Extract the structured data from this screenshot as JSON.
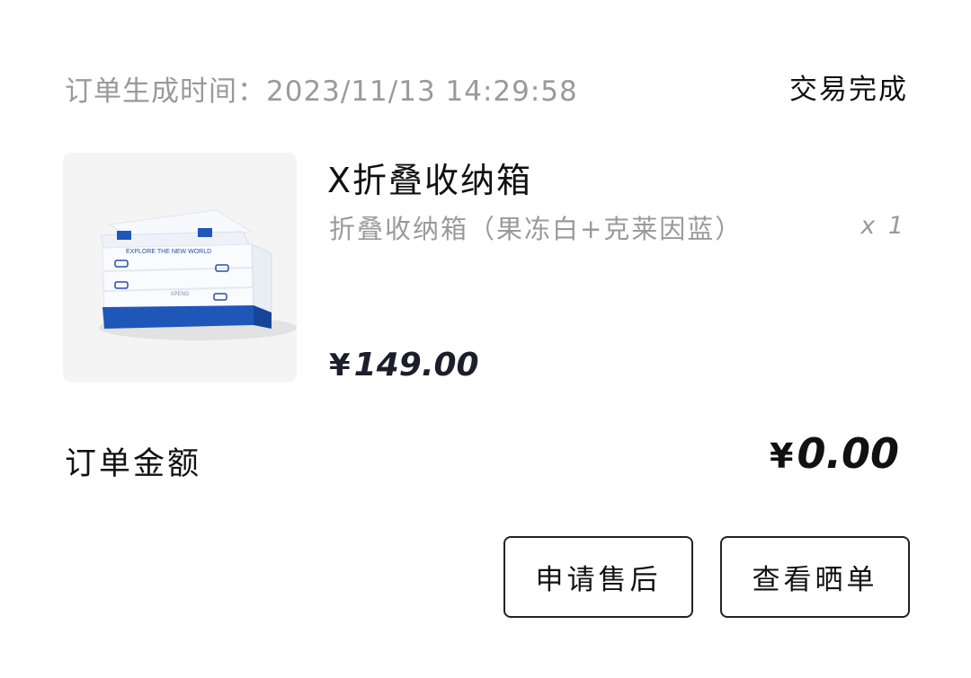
{
  "order": {
    "time_label": "订单生成时间：",
    "time_value": "2023/11/13 14:29:58",
    "status": "交易完成"
  },
  "product": {
    "title": "X折叠收纳箱",
    "spec": "折叠收纳箱（果冻白+克莱因蓝）",
    "quantity": "x 1",
    "price_currency": "¥",
    "price_value": "149.00",
    "image_print": "EXPLORE THE NEW WORLD",
    "image_brand": "XPENG"
  },
  "total": {
    "label": "订单金额",
    "currency": "¥",
    "value": "0.00"
  },
  "actions": {
    "after_sale": "申请售后",
    "view_review": "查看晒单"
  },
  "colors": {
    "text_primary": "#111111",
    "text_secondary": "#9a9a9a",
    "price": "#1c1f2b",
    "box_blue": "#1f57b8"
  }
}
